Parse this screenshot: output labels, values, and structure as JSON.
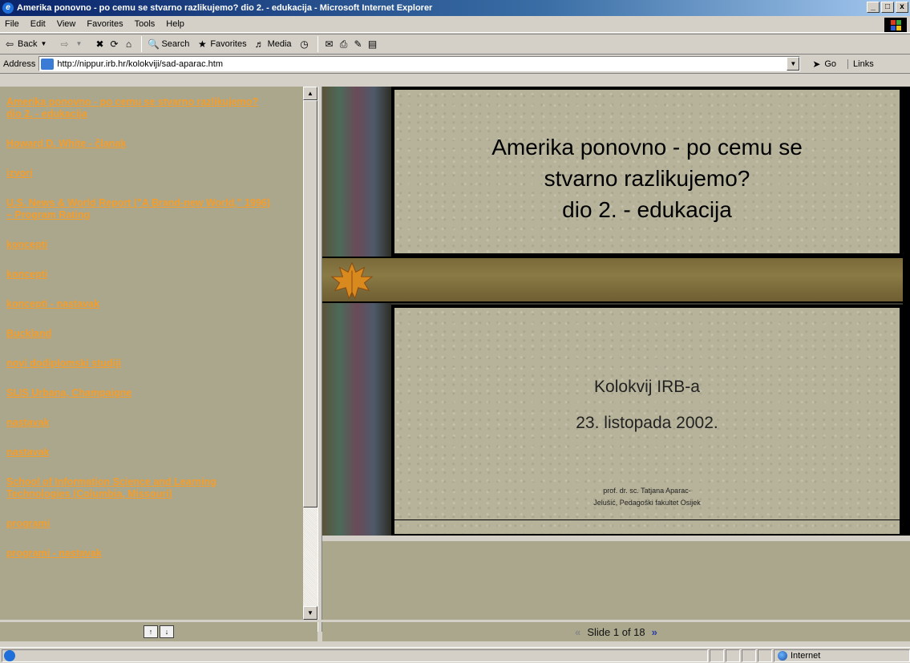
{
  "window": {
    "title": "Amerika ponovno - po cemu se stvarno razlikujemo? dio 2. - edukacija - Microsoft Internet Explorer",
    "buttons": [
      "_",
      "ő",
      "x"
    ]
  },
  "menu": [
    "File",
    "Edit",
    "View",
    "Favorites",
    "Tools",
    "Help"
  ],
  "toolbar": {
    "back": "Back",
    "search": "Search",
    "favorites": "Favorites",
    "media": "Media"
  },
  "address": {
    "label": "Address",
    "url": "http://nippur.irb.hr/kolokviji/sad-aparac.htm",
    "go": "Go",
    "links": "Links"
  },
  "outline": [
    "Amerika ponovno - po cemu se stvarno razlikujemo?\ndio 2. - edukacija",
    "Howard D. White - članak",
    "izvori",
    "U.S. News & World Report (\"A Brand-new World,\" 1996) – Program Rating",
    "koncepti",
    "koncepti",
    "koncepti - nastavak",
    "Buckland",
    "novi dodiplomski studiji",
    "SLIS Urbana, Champaigne",
    "nastavak",
    "nastavak",
    "School of Information Science and Learning Technologies (Columbia, Missouri)",
    "programi",
    "programi - nastavak"
  ],
  "slide": {
    "title_line1": "Amerika ponovno - po cemu se",
    "title_line2": "stvarno razlikujemo?",
    "title_line3": "dio 2. - edukacija",
    "subtitle1": "Kolokvij IRB-a",
    "subtitle2": "23. listopada 2002.",
    "author_line1": "prof. dr. sc. Tatjana Aparac-",
    "author_line2": "Jelušić,  Pedagoški fakultet Osijek"
  },
  "nav": {
    "slide_label": "Slide 1 of 18"
  },
  "status": {
    "zone": "Internet"
  }
}
